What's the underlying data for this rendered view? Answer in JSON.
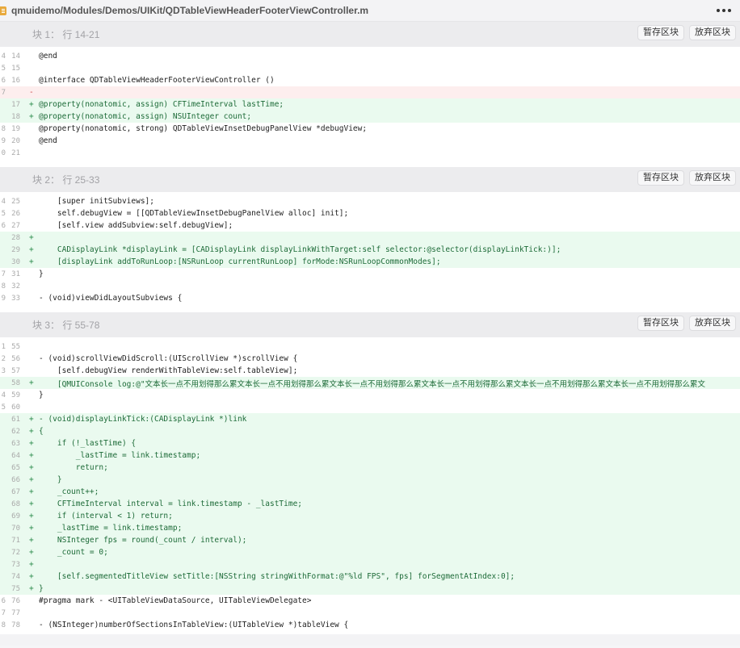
{
  "file": {
    "path": "qmuidemo/Modules/Demos/UIKit/QDTableViewHeaderFooterViewController.m",
    "icon": "objc-file-icon",
    "more_icon": "more-horizontal-icon"
  },
  "buttons": {
    "stage": "暂存区块",
    "discard": "放弃区块"
  },
  "hunks": [
    {
      "title": "块 1： 行 14-21",
      "lines": [
        {
          "old": "4",
          "new": "14",
          "type": "context",
          "code": "@end"
        },
        {
          "old": "5",
          "new": "15",
          "type": "context",
          "code": ""
        },
        {
          "old": "6",
          "new": "16",
          "type": "context",
          "code": "@interface QDTableViewHeaderFooterViewController ()"
        },
        {
          "old": "7",
          "new": "",
          "type": "removed",
          "code": ""
        },
        {
          "old": "",
          "new": "17",
          "type": "added",
          "code": "@property(nonatomic, assign) CFTimeInterval lastTime;"
        },
        {
          "old": "",
          "new": "18",
          "type": "added",
          "code": "@property(nonatomic, assign) NSUInteger count;"
        },
        {
          "old": "8",
          "new": "19",
          "type": "context",
          "code": "@property(nonatomic, strong) QDTableViewInsetDebugPanelView *debugView;"
        },
        {
          "old": "9",
          "new": "20",
          "type": "context",
          "code": "@end"
        },
        {
          "old": "0",
          "new": "21",
          "type": "context",
          "code": ""
        }
      ]
    },
    {
      "title": "块 2： 行 25-33",
      "lines": [
        {
          "old": "4",
          "new": "25",
          "type": "context",
          "code": "    [super initSubviews];"
        },
        {
          "old": "5",
          "new": "26",
          "type": "context",
          "code": "    self.debugView = [[QDTableViewInsetDebugPanelView alloc] init];"
        },
        {
          "old": "6",
          "new": "27",
          "type": "context",
          "code": "    [self.view addSubview:self.debugView];"
        },
        {
          "old": "",
          "new": "28",
          "type": "added",
          "code": ""
        },
        {
          "old": "",
          "new": "29",
          "type": "added",
          "code": "    CADisplayLink *displayLink = [CADisplayLink displayLinkWithTarget:self selector:@selector(displayLinkTick:)];"
        },
        {
          "old": "",
          "new": "30",
          "type": "added",
          "code": "    [displayLink addToRunLoop:[NSRunLoop currentRunLoop] forMode:NSRunLoopCommonModes];"
        },
        {
          "old": "7",
          "new": "31",
          "type": "context",
          "code": "}"
        },
        {
          "old": "8",
          "new": "32",
          "type": "context",
          "code": ""
        },
        {
          "old": "9",
          "new": "33",
          "type": "context",
          "code": "- (void)viewDidLayoutSubviews {"
        }
      ]
    },
    {
      "title": "块 3： 行 55-78",
      "lines": [
        {
          "old": "1",
          "new": "55",
          "type": "context",
          "code": ""
        },
        {
          "old": "2",
          "new": "56",
          "type": "context",
          "code": "- (void)scrollViewDidScroll:(UIScrollView *)scrollView {"
        },
        {
          "old": "3",
          "new": "57",
          "type": "context",
          "code": "    [self.debugView renderWithTableView:self.tableView];"
        },
        {
          "old": "",
          "new": "58",
          "type": "added",
          "code": "    [QMUIConsole log:@\"文本长一点不用划得那么累文本长一点不用划得那么累文本长一点不用划得那么累文本长一点不用划得那么累文本长一点不用划得那么累文本长一点不用划得那么累文"
        },
        {
          "old": "4",
          "new": "59",
          "type": "context",
          "code": "}"
        },
        {
          "old": "5",
          "new": "60",
          "type": "context",
          "code": ""
        },
        {
          "old": "",
          "new": "61",
          "type": "added",
          "code": "- (void)displayLinkTick:(CADisplayLink *)link"
        },
        {
          "old": "",
          "new": "62",
          "type": "added",
          "code": "{"
        },
        {
          "old": "",
          "new": "63",
          "type": "added",
          "code": "    if (!_lastTime) {"
        },
        {
          "old": "",
          "new": "64",
          "type": "added",
          "code": "        _lastTime = link.timestamp;"
        },
        {
          "old": "",
          "new": "65",
          "type": "added",
          "code": "        return;"
        },
        {
          "old": "",
          "new": "66",
          "type": "added",
          "code": "    }"
        },
        {
          "old": "",
          "new": "67",
          "type": "added",
          "code": "    _count++;"
        },
        {
          "old": "",
          "new": "68",
          "type": "added",
          "code": "    CFTimeInterval interval = link.timestamp - _lastTime;"
        },
        {
          "old": "",
          "new": "69",
          "type": "added",
          "code": "    if (interval < 1) return;"
        },
        {
          "old": "",
          "new": "70",
          "type": "added",
          "code": "    _lastTime = link.timestamp;"
        },
        {
          "old": "",
          "new": "71",
          "type": "added",
          "code": "    NSInteger fps = round(_count / interval);"
        },
        {
          "old": "",
          "new": "72",
          "type": "added",
          "code": "    _count = 0;"
        },
        {
          "old": "",
          "new": "73",
          "type": "added",
          "code": ""
        },
        {
          "old": "",
          "new": "74",
          "type": "added",
          "code": "    [self.segmentedTitleView setTitle:[NSString stringWithFormat:@\"%ld FPS\", fps] forSegmentAtIndex:0];"
        },
        {
          "old": "",
          "new": "75",
          "type": "added",
          "code": "}"
        },
        {
          "old": "6",
          "new": "76",
          "type": "context",
          "code": "#pragma mark - <UITableViewDataSource, UITableViewDelegate>"
        },
        {
          "old": "7",
          "new": "77",
          "type": "context",
          "code": ""
        },
        {
          "old": "8",
          "new": "78",
          "type": "context",
          "code": "- (NSInteger)numberOfSectionsInTableView:(UITableView *)tableView {"
        }
      ]
    }
  ]
}
